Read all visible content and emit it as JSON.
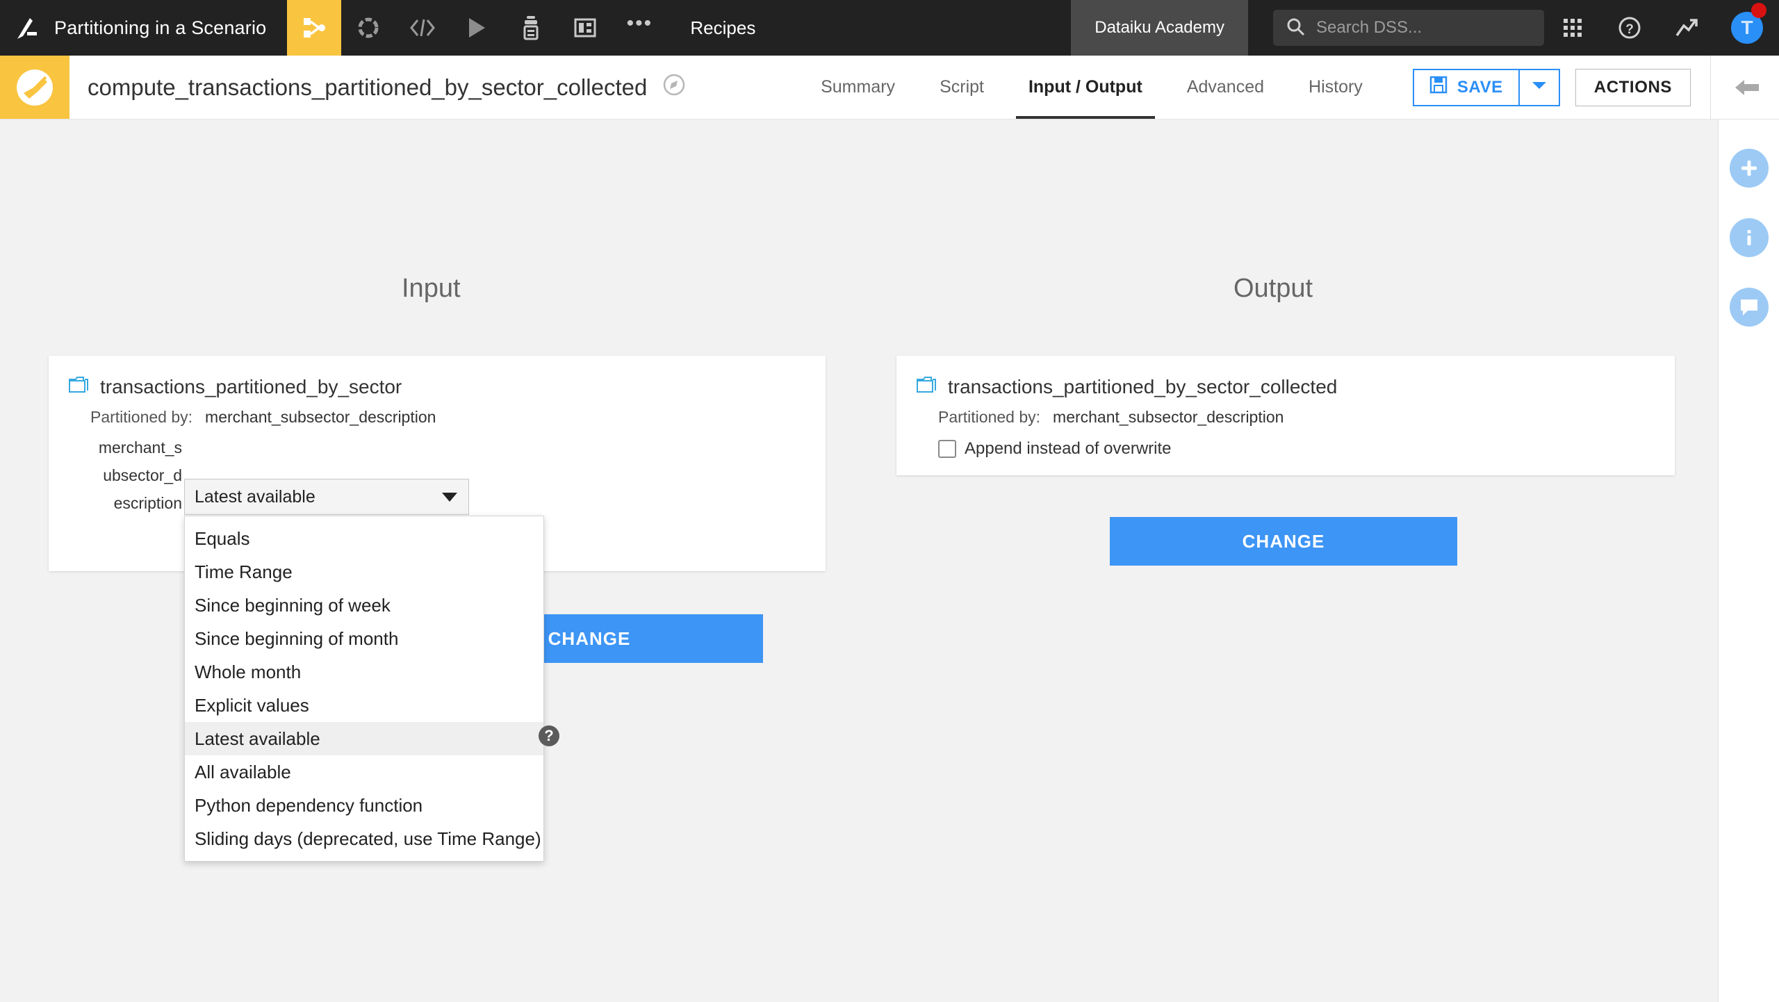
{
  "topbar": {
    "logo_icon": "dataiku-bird-logo",
    "project_name": "Partitioning in a Scenario",
    "nav_icons": [
      {
        "name": "flow-icon",
        "active": true
      },
      {
        "name": "lab-icon",
        "active": false
      },
      {
        "name": "code-icon",
        "active": false
      },
      {
        "name": "jobs-run-icon",
        "active": false
      },
      {
        "name": "automation-icon",
        "active": false
      },
      {
        "name": "dashboard-icon",
        "active": false
      }
    ],
    "more_label": "•••",
    "section_label": "Recipes",
    "academy_label": "Dataiku Academy",
    "search": {
      "placeholder": "Search DSS...",
      "value": "",
      "icon": "search-icon"
    },
    "apps_icon": "apps-grid-icon",
    "help_icon": "help-circle-icon",
    "activity_icon": "trending-up-icon",
    "avatar_initial": "T",
    "has_notification": true
  },
  "recipe_header": {
    "recipe_icon": "broom-prepare-recipe-icon",
    "title": "compute_transactions_partitioned_by_sector_collected",
    "compass_icon": "compass-icon",
    "tabs": [
      {
        "label": "Summary",
        "active": false
      },
      {
        "label": "Script",
        "active": false
      },
      {
        "label": "Input / Output",
        "active": true
      },
      {
        "label": "Advanced",
        "active": false
      },
      {
        "label": "History",
        "active": false
      }
    ],
    "save_label": "SAVE",
    "save_icon": "floppy-disk-icon",
    "save_caret_icon": "chevron-down-icon",
    "actions_label": "ACTIONS",
    "back_icon": "arrow-left-icon"
  },
  "right_rail": {
    "buttons": [
      {
        "name": "add-icon",
        "glyph": "+"
      },
      {
        "name": "info-icon",
        "glyph": "i"
      },
      {
        "name": "chat-icon",
        "glyph": "●"
      }
    ]
  },
  "main": {
    "input_title": "Input",
    "output_title": "Output",
    "input": {
      "folder_icon": "managed-folder-icon",
      "dataset_name": "transactions_partitioned_by_sector",
      "partitioned_by_label": "Partitioned by:",
      "partitioned_by_value": "merchant_subsector_description",
      "dimension_label": "merchant_subsector_description",
      "change_label": "CHANGE",
      "help_glyph": "?"
    },
    "output": {
      "folder_icon": "managed-folder-icon",
      "dataset_name": "transactions_partitioned_by_sector_collected",
      "partitioned_by_label": "Partitioned by:",
      "partitioned_by_value": "merchant_subsector_description",
      "append_label": "Append instead of overwrite",
      "append_checked": false,
      "change_label": "CHANGE"
    },
    "dependency_select": {
      "value": "Latest available",
      "open": true,
      "options": [
        "Equals",
        "Time Range",
        "Since beginning of week",
        "Since beginning of month",
        "Whole month",
        "Explicit values",
        "Latest available",
        "All available",
        "Python dependency function",
        "Sliding days (deprecated, use Time Range)"
      ],
      "selected_index": 6
    }
  },
  "colors": {
    "brand_yellow": "#f9c440",
    "accent_blue": "#3d95f5",
    "topbar_dark": "#222222",
    "canvas_gray": "#f2f2f2",
    "folder_blue": "#35a8e0"
  }
}
